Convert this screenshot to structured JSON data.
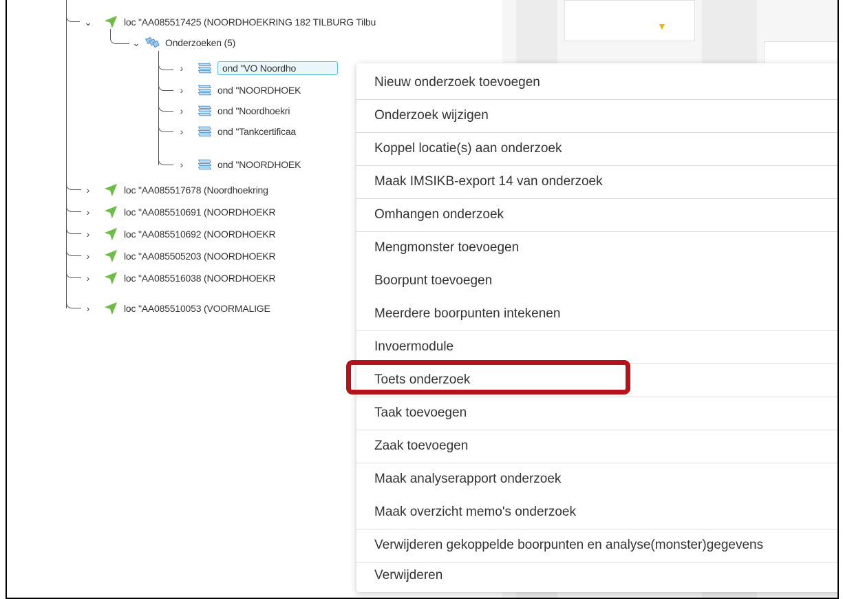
{
  "tree": {
    "loc_main": "loc \"AA085517425 (NOORDHOEKRING 182 TILBURG Tilbu",
    "onderzoeken": "Onderzoeken (5)",
    "ond_items": [
      "ond \"VO Noordho",
      "ond \"NOORDHOEK",
      "ond \"Noordhoekri",
      "ond \"Tankcertificaa",
      "ond \"NOORDHOEK"
    ],
    "loc_items": [
      "loc \"AA085517678 (Noordhoekring",
      "loc \"AA085510691 (NOORDHOEKR",
      "loc \"AA085510692 (NOORDHOEKR",
      "loc \"AA085505203 (NOORDHOEKR",
      "loc \"AA085516038 (NOORDHOEKR",
      "loc \"AA085510053 (VOORMALIGE"
    ]
  },
  "menu": {
    "items": [
      "Nieuw onderzoek toevoegen",
      "Onderzoek wijzigen",
      "Koppel locatie(s) aan onderzoek",
      "Maak IMSIKB-export 14 van onderzoek",
      "Omhangen onderzoek",
      "Mengmonster toevoegen",
      "Boorpunt toevoegen",
      "Meerdere boorpunten intekenen",
      "Invoermodule",
      "Toets onderzoek",
      "Taak toevoegen",
      "Zaak toevoegen",
      "Maak analyserapport onderzoek",
      "Maak overzicht memo's onderzoek",
      "Verwijderen gekoppelde boorpunten en analyse(monster)gegevens",
      "Verwijderen"
    ]
  },
  "colors": {
    "loc_icon": "#6cbd45",
    "ond_icon": "#3d88c9",
    "selection": "#5dbfd6",
    "highlight": "#b5121b"
  },
  "icons": {
    "loc": "location-arrow-icon",
    "ond": "investigation-stack-icon",
    "onderzoeken": "investigations-folder-icon"
  }
}
